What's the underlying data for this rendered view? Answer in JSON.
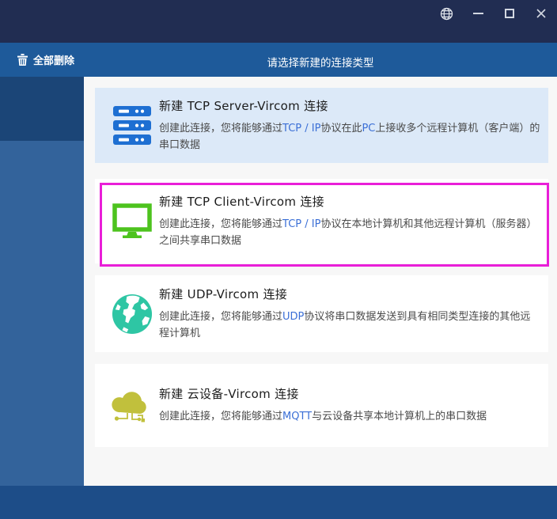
{
  "window": {
    "titlebar": {
      "controls": [
        {
          "name": "language-globe",
          "type": "globe"
        },
        {
          "name": "minimize",
          "type": "minimize"
        },
        {
          "name": "maximize",
          "type": "maximize"
        },
        {
          "name": "close",
          "type": "close"
        }
      ]
    },
    "header": {
      "delete_all_label": "全部删除",
      "prompt": "请选择新建的连接类型"
    }
  },
  "colors": {
    "titlebar": "#212d52",
    "headerbar": "#1e5a9a",
    "sidebar": "#33639b",
    "sidebar_active": "#1b4577",
    "bottombar": "#1d4d88",
    "card1_bg": "#dce9f8",
    "highlight": "#e91ed8",
    "server_icon": "#1e6fd2",
    "monitor_icon": "#4dc31e",
    "globe_icon": "#2ec6a4",
    "cloud_icon": "#c1c03c",
    "latin_text": "#3b6fd6"
  },
  "cards": [
    {
      "id": "tcp-server",
      "icon": "server-icon",
      "title": "新建 TCP Server-Vircom 连接",
      "desc": [
        {
          "text": "创建此连接，您将能够通过",
          "style": "cn"
        },
        {
          "text": "TCP / IP",
          "style": "en"
        },
        {
          "text": "协议在此",
          "style": "cn"
        },
        {
          "text": "PC",
          "style": "en"
        },
        {
          "text": "上接收多个远程计算机（客户端）的串口数据",
          "style": "cn"
        }
      ],
      "highlighted": false
    },
    {
      "id": "tcp-client",
      "icon": "monitor-icon",
      "title": "新建 TCP Client-Vircom 连接",
      "desc": [
        {
          "text": "创建此连接，您将能够通过",
          "style": "cn"
        },
        {
          "text": "TCP / IP",
          "style": "en"
        },
        {
          "text": "协议在本地计算机和其他远程计算机（服务器）之间共享串口数据",
          "style": "cn"
        }
      ],
      "highlighted": true
    },
    {
      "id": "udp",
      "icon": "globe-icon",
      "title": "新建 UDP-Vircom  连接",
      "desc": [
        {
          "text": "创建此连接，您将能够通过",
          "style": "cn"
        },
        {
          "text": "UDP",
          "style": "en"
        },
        {
          "text": "协议将串口数据发送到具有相同类型连接的其他远程计算机",
          "style": "cn"
        }
      ],
      "highlighted": false
    },
    {
      "id": "cloud-device",
      "icon": "cloud-icon",
      "title": "新建 云设备-Vircom 连接",
      "desc": [
        {
          "text": "创建此连接，您将能够通过",
          "style": "cn"
        },
        {
          "text": "MQTT",
          "style": "en"
        },
        {
          "text": "与云设备共享本地计算机上的串口数据",
          "style": "cn"
        }
      ],
      "highlighted": false
    }
  ]
}
